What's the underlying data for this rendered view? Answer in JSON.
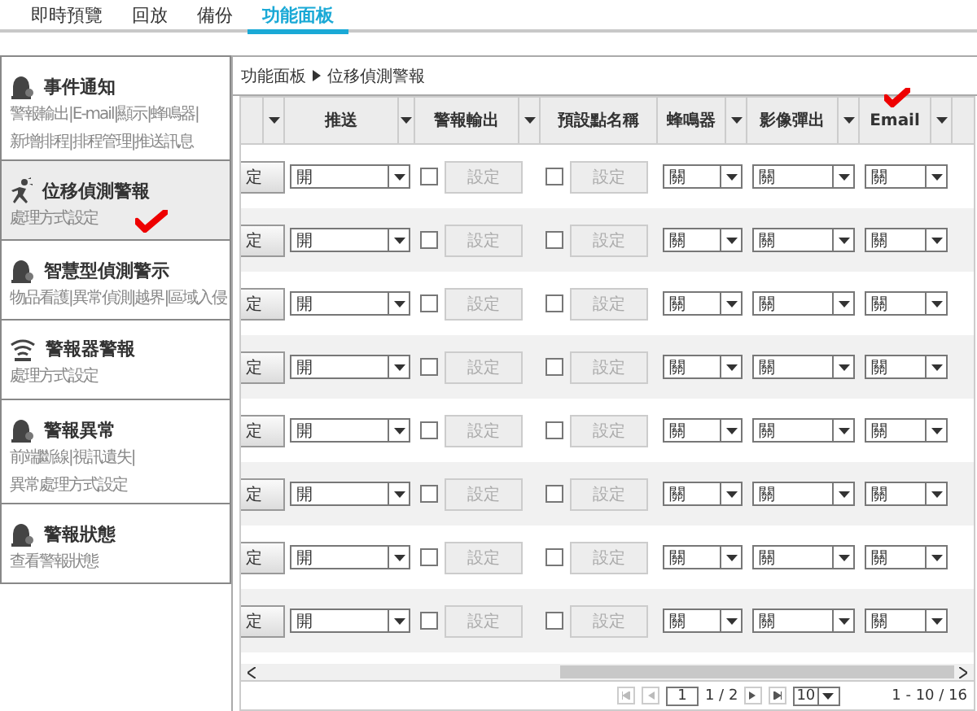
{
  "tabs": [
    {
      "label": "即時預覽",
      "selected": false
    },
    {
      "label": "回放",
      "selected": false
    },
    {
      "label": "備份",
      "selected": false
    },
    {
      "label": "功能面板",
      "selected": true
    }
  ],
  "sidebar": {
    "items": [
      {
        "title": "事件通知",
        "lines": [
          "警報輸出|E-mail|顯示|蜂鳴器|",
          "新增排程|排程管理|推送訊息"
        ],
        "selected": false
      },
      {
        "title": "位移偵測警報",
        "lines": [
          "處理方式設定"
        ],
        "selected": true
      },
      {
        "title": "智慧型偵測警示",
        "lines": [
          "物品看護|異常偵測|越界|區域入侵"
        ],
        "selected": false
      },
      {
        "title": "警報器警報",
        "lines": [
          "處理方式設定"
        ],
        "selected": false
      },
      {
        "title": "警報異常",
        "lines": [
          "前端斷線|視訊遺失|",
          "異常處理方式設定"
        ],
        "selected": false
      },
      {
        "title": "警報狀態",
        "lines": [
          "查看警報狀態"
        ],
        "selected": false
      }
    ]
  },
  "breadcrumb": [
    "功能面板",
    "位移偵測警報"
  ],
  "table": {
    "columns": [
      {
        "has_menu": true
      },
      {
        "label": "推送",
        "has_menu": true
      },
      {
        "label": "警報輸出",
        "has_menu": true
      },
      {
        "label": "預設點名稱",
        "has_menu": false
      },
      {
        "label": "蜂鳴器",
        "has_menu": true
      },
      {
        "label": "影像彈出",
        "has_menu": true
      },
      {
        "label": "Email",
        "has_menu": true
      }
    ],
    "rows": [
      {
        "button": "定",
        "push": "開",
        "output_checked": false,
        "output_button": "設定",
        "preset_checked": false,
        "preset_button": "設定",
        "buzzer": "關",
        "popup": "關",
        "email": "關"
      },
      {
        "button": "定",
        "push": "開",
        "output_checked": false,
        "output_button": "設定",
        "preset_checked": false,
        "preset_button": "設定",
        "buzzer": "關",
        "popup": "關",
        "email": "關"
      },
      {
        "button": "定",
        "push": "開",
        "output_checked": false,
        "output_button": "設定",
        "preset_checked": false,
        "preset_button": "設定",
        "buzzer": "關",
        "popup": "關",
        "email": "關"
      },
      {
        "button": "定",
        "push": "開",
        "output_checked": false,
        "output_button": "設定",
        "preset_checked": false,
        "preset_button": "設定",
        "buzzer": "關",
        "popup": "關",
        "email": "關"
      },
      {
        "button": "定",
        "push": "開",
        "output_checked": false,
        "output_button": "設定",
        "preset_checked": false,
        "preset_button": "設定",
        "buzzer": "關",
        "popup": "關",
        "email": "關"
      },
      {
        "button": "定",
        "push": "開",
        "output_checked": false,
        "output_button": "設定",
        "preset_checked": false,
        "preset_button": "設定",
        "buzzer": "關",
        "popup": "關",
        "email": "關"
      },
      {
        "button": "定",
        "push": "開",
        "output_checked": false,
        "output_button": "設定",
        "preset_checked": false,
        "preset_button": "設定",
        "buzzer": "關",
        "popup": "關",
        "email": "關"
      },
      {
        "button": "定",
        "push": "開",
        "output_checked": false,
        "output_button": "設定",
        "preset_checked": false,
        "preset_button": "設定",
        "buzzer": "關",
        "popup": "關",
        "email": "關"
      }
    ]
  },
  "pager": {
    "page": "1",
    "pages": "1 / 2",
    "page_size": "10",
    "range": "1 - 10 / 16"
  }
}
